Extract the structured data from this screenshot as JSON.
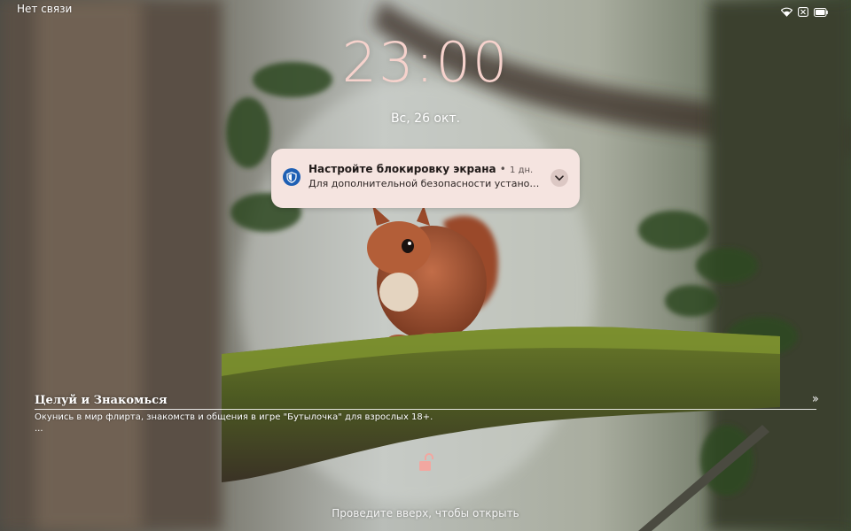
{
  "status_bar": {
    "carrier": "Нет связи",
    "icons": [
      "wifi-icon",
      "no-sim-icon",
      "battery-icon"
    ]
  },
  "lockscreen": {
    "clock": "23:00",
    "date": "Вс, 26 окт.",
    "swipe_hint": "Проведите вверх, чтобы открыть"
  },
  "notification": {
    "icon": "shield-icon",
    "title": "Настройте блокировку экрана",
    "separator": "•",
    "age": "1 дн.",
    "text": "Для дополнительной безопасности установите PIN-код, графический ключ или пароль"
  },
  "promo": {
    "title": "Целуй и Знакомься",
    "text": "Окунись в мир флирта, знакомств и общения в игре \"Бутылочка\" для взрослых 18+.",
    "more": "...",
    "arrows": "››"
  },
  "colors": {
    "clock": "#f6d2cc",
    "notification_bg": "#f5e4e0",
    "shield": "#1e5fb4",
    "lock": "#f2a7a0"
  }
}
